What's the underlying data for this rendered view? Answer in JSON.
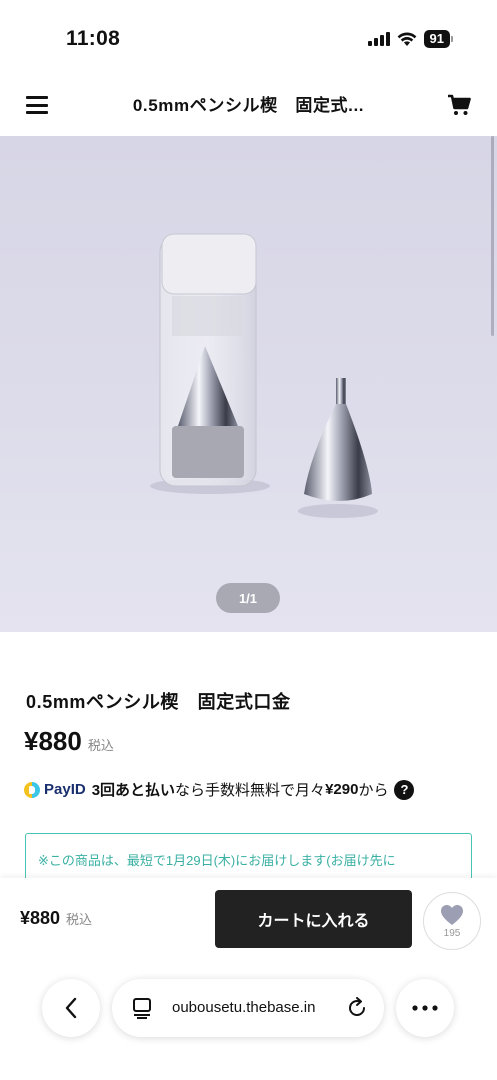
{
  "status_bar": {
    "time": "11:08",
    "battery": "91"
  },
  "header": {
    "title": "0.5mmペンシル楔　固定式..."
  },
  "gallery": {
    "counter": "1/1"
  },
  "product": {
    "title": "0.5mmペンシル楔　固定式口金",
    "price": "¥880",
    "tax_label": "税込"
  },
  "payid": {
    "brand": "PayID",
    "highlight": "3回あと払い",
    "text_mid": "なら手数料無料で月々",
    "amount": "¥290",
    "text_end": "から",
    "help": "?"
  },
  "delivery": {
    "text": "※この商品は、最短で1月29日(木)にお届けします(お届け先に"
  },
  "buy_bar": {
    "price": "¥880",
    "tax_label": "税込",
    "add_to_cart": "カートに入れる",
    "like_count": "195"
  },
  "browser": {
    "url": "oubousetu.thebase.in"
  },
  "colors": {
    "accent_teal": "#49c3b6",
    "button_dark": "#222222",
    "background_photo": "#dcdbe9"
  },
  "icons": [
    "signal-icon",
    "wifi-icon",
    "battery-icon",
    "menu-icon",
    "cart-icon",
    "payid-logo-icon",
    "help-icon",
    "heart-icon",
    "back-icon",
    "tabs-icon",
    "reload-icon",
    "more-icon"
  ]
}
